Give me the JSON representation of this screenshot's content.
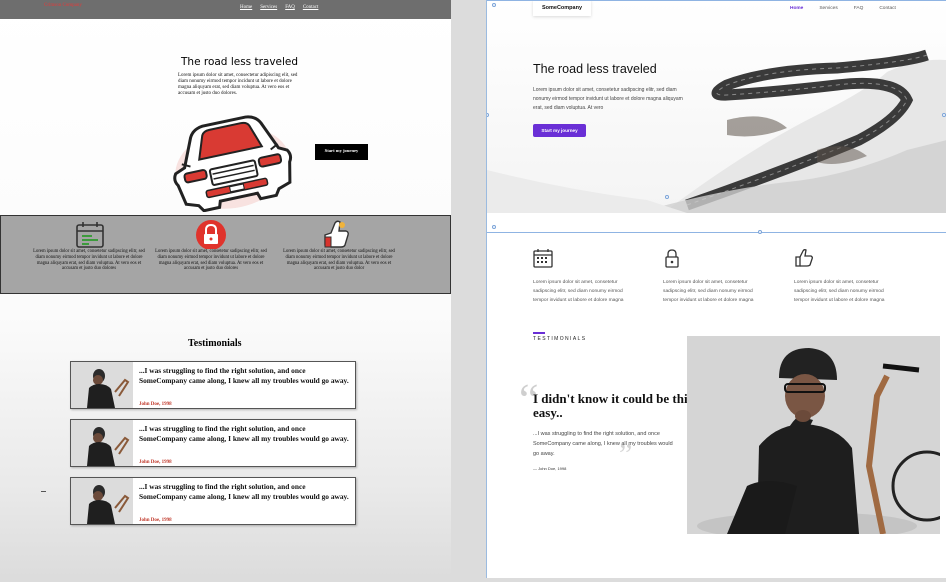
{
  "left_preview": {
    "nav": {
      "brand": "Crimson Company",
      "links": [
        "Home",
        "Services",
        "FAQ",
        "Contact"
      ]
    },
    "hero": {
      "title": "The road less traveled",
      "paragraph": "Lorem ipsum dolor sit amet, consectetur adipiscing elit, sed diam nonumy eirmod tempor incidunt ut labore et dolore magna aliquyam erat, sed diam voluptua. At vero eos et accusam et justo duo dolores.",
      "cta": "Start my journey"
    },
    "features": [
      {
        "icon": "calendar-icon",
        "text": "Lorem ipsum dolor sit amet, consetetur sadipscing elitr, sed diam nonumy eirmod tempor invidunt ut labore et dolore magna aliquyam erat, sed diam voluptua. At vero eos et accusam et justo duo dolores"
      },
      {
        "icon": "lock-icon",
        "text": "Lorem ipsum dolor sit amet, consetetur sadipscing elitr, sed diam nonumy eirmod tempor invidunt ut labore et dolore magna aliquyam erat, sed diam voluptua. At vero eos et accusam et justo duo dolores"
      },
      {
        "icon": "thumbs-up-icon",
        "text": "Lorem ipsum dolor sit amet, consetetur sadipscing elitr, sed diam nonumy eirmod tempor invidunt ut labore et dolore magna aliquyam erat, sed diam voluptua. At vero eos et accusam et justo duo dolor"
      }
    ],
    "testimonials": {
      "title": "Testimonials",
      "items": [
        {
          "quote": "...I was struggling to find the right solution, and once SomeCompany came along, I knew all my troubles would go away.",
          "author": "John Doe, 1998"
        },
        {
          "quote": "...I was struggling to find the right solution, and once SomeCompany came along, I knew all my troubles would go away.",
          "author": "John Doe, 1998"
        },
        {
          "quote": "...I was struggling to find the right solution, and once SomeCompany came along, I knew all my troubles would go away.",
          "author": "John Doe, 1998"
        }
      ]
    }
  },
  "right_design": {
    "nav": {
      "brand": "SomeCompany",
      "links": [
        "Home",
        "Services",
        "FAQ",
        "Contact"
      ],
      "active": "Home"
    },
    "hero": {
      "title": "The road less traveled",
      "paragraph": "Lorem ipsum dolor sit amet, consetetur sadipscing elitr, sed diam nonumy eirmod tempor invidunt ut labore et dolore magna aliquyam erat, sed diam voluptua. At vero",
      "cta": "Start my journey"
    },
    "features": [
      {
        "icon": "calendar-icon",
        "text": "Lorem ipsum dolor sit amet, consetetur sadipscing elitr, sed diam nonumy eirmod tempor invidunt ut labore et dolore magna"
      },
      {
        "icon": "lock-icon",
        "text": "Lorem ipsum dolor sit amet, consetetur sadipscing elitr, sed diam nonumy eirmod tempor invidunt ut labore et dolore magna"
      },
      {
        "icon": "thumbs-up-icon",
        "text": "Lorem ipsum dolor sit amet, consetetur sadipscing elitr, sed diam nonumy eirmod tempor invidunt ut labore et dolore magna"
      }
    ],
    "testimonials": {
      "label": "TESTIMONIALS",
      "headline": "I didn't know it could be this easy..",
      "quote": "...I was struggling to find the right solution, and once SomeCompany came along, I knew all my troubles would go away.",
      "author": "— John Doe, 1998"
    }
  },
  "colors": {
    "accent_purple": "#6a2fd6",
    "left_brand_red": "#e23b3b",
    "left_nav_gray": "#6e6e6e",
    "feature_band_gray": "#a5a5a5"
  }
}
